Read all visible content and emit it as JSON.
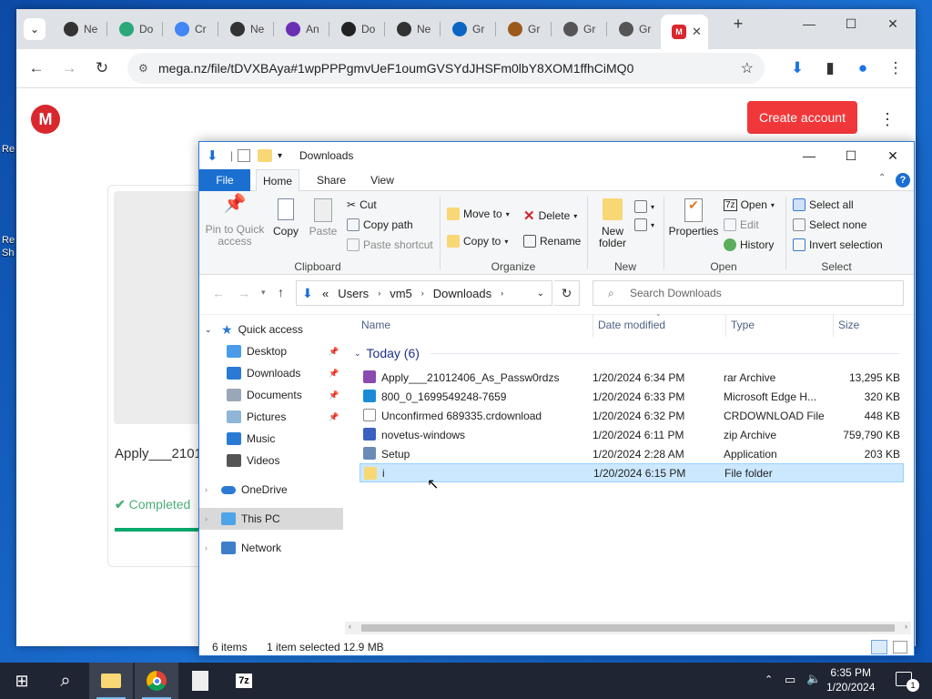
{
  "desktop": {
    "label1": "Re",
    "label2": "Re",
    "label2b": "Sh"
  },
  "chrome": {
    "tabs": [
      {
        "label": "Ne",
        "icon": "github-icon",
        "color": "#333"
      },
      {
        "label": "Do",
        "icon": "diamond-icon",
        "color": "#2aa87a"
      },
      {
        "label": "Cr",
        "icon": "google-icon",
        "color": "#4285f4"
      },
      {
        "label": "Ne",
        "icon": "github-icon",
        "color": "#333"
      },
      {
        "label": "An",
        "icon": "android-icon",
        "color": "#6b2fb3"
      },
      {
        "label": "Do",
        "icon": "doc-icon",
        "color": "#222"
      },
      {
        "label": "Ne",
        "icon": "github-icon",
        "color": "#333"
      },
      {
        "label": "Gr",
        "icon": "linkedin-icon",
        "color": "#0a66c2"
      },
      {
        "label": "Gr",
        "icon": "gr-icon",
        "color": "#9b5a1c"
      },
      {
        "label": "Gr",
        "icon": "globe-icon",
        "color": "#555"
      },
      {
        "label": "Gr",
        "icon": "globe-icon",
        "color": "#555"
      }
    ],
    "active_tab_icon": "M",
    "active_tab_close": "✕",
    "new_tab": "+",
    "url": "mega.nz/file/tDVXBAya#1wpPPPgmvUeF1oumGVSYdJHSFm0lbY8XOM1ffhCiMQ0"
  },
  "mega": {
    "logo": "M",
    "create_account": "Create account",
    "file_name": "Apply___2101",
    "status": "Completed",
    "progress": 1.0
  },
  "explorer": {
    "title": "Downloads",
    "ribbon_tabs": [
      "File",
      "Home",
      "Share",
      "View"
    ],
    "clipboard": {
      "pin": "Pin to Quick access",
      "copy": "Copy",
      "paste": "Paste",
      "cut": "Cut",
      "copy_path": "Copy path",
      "paste_shortcut": "Paste shortcut",
      "label": "Clipboard"
    },
    "organize": {
      "move_to": "Move to",
      "copy_to": "Copy to",
      "delete": "Delete",
      "rename": "Rename",
      "label": "Organize"
    },
    "new": {
      "new_folder": "New folder",
      "label": "New"
    },
    "open": {
      "properties": "Properties",
      "open": "Open",
      "edit": "Edit",
      "history": "History",
      "label": "Open"
    },
    "select": {
      "select_all": "Select all",
      "select_none": "Select none",
      "invert": "Invert selection",
      "label": "Select"
    },
    "address": {
      "prefix": "«",
      "parts": [
        "Users",
        "vm5",
        "Downloads"
      ]
    },
    "search_placeholder": "Search Downloads",
    "nav": {
      "quick_access": "Quick access",
      "items": [
        "Desktop",
        "Downloads",
        "Documents",
        "Pictures",
        "Music",
        "Videos"
      ],
      "onedrive": "OneDrive",
      "this_pc": "This PC",
      "network": "Network"
    },
    "columns": {
      "name": "Name",
      "date": "Date modified",
      "type": "Type",
      "size": "Size"
    },
    "group": "Today (6)",
    "files": [
      {
        "name": "Apply___21012406_As_Passw0rdzs",
        "date": "1/20/2024 6:34 PM",
        "type": "rar Archive",
        "size": "13,295 KB",
        "icon": "rar-icon"
      },
      {
        "name": "800_0_1699549248-7659",
        "date": "1/20/2024 6:33 PM",
        "type": "Microsoft Edge H...",
        "size": "320 KB",
        "icon": "edge-icon"
      },
      {
        "name": "Unconfirmed 689335.crdownload",
        "date": "1/20/2024 6:32 PM",
        "type": "CRDOWNLOAD File",
        "size": "448 KB",
        "icon": "file-icon"
      },
      {
        "name": "novetus-windows",
        "date": "1/20/2024 6:11 PM",
        "type": "zip Archive",
        "size": "759,790 KB",
        "icon": "zip-icon"
      },
      {
        "name": "Setup",
        "date": "1/20/2024 2:28 AM",
        "type": "Application",
        "size": "203 KB",
        "icon": "app-icon"
      },
      {
        "name": "i",
        "date": "1/20/2024 6:15 PM",
        "type": "File folder",
        "size": "",
        "icon": "folder-icon"
      }
    ],
    "status": {
      "count": "6 items",
      "selected": "1 item selected",
      "size": "12.9 MB"
    }
  },
  "taskbar": {
    "time": "6:35 PM",
    "date": "1/20/2024",
    "notif": "1"
  }
}
